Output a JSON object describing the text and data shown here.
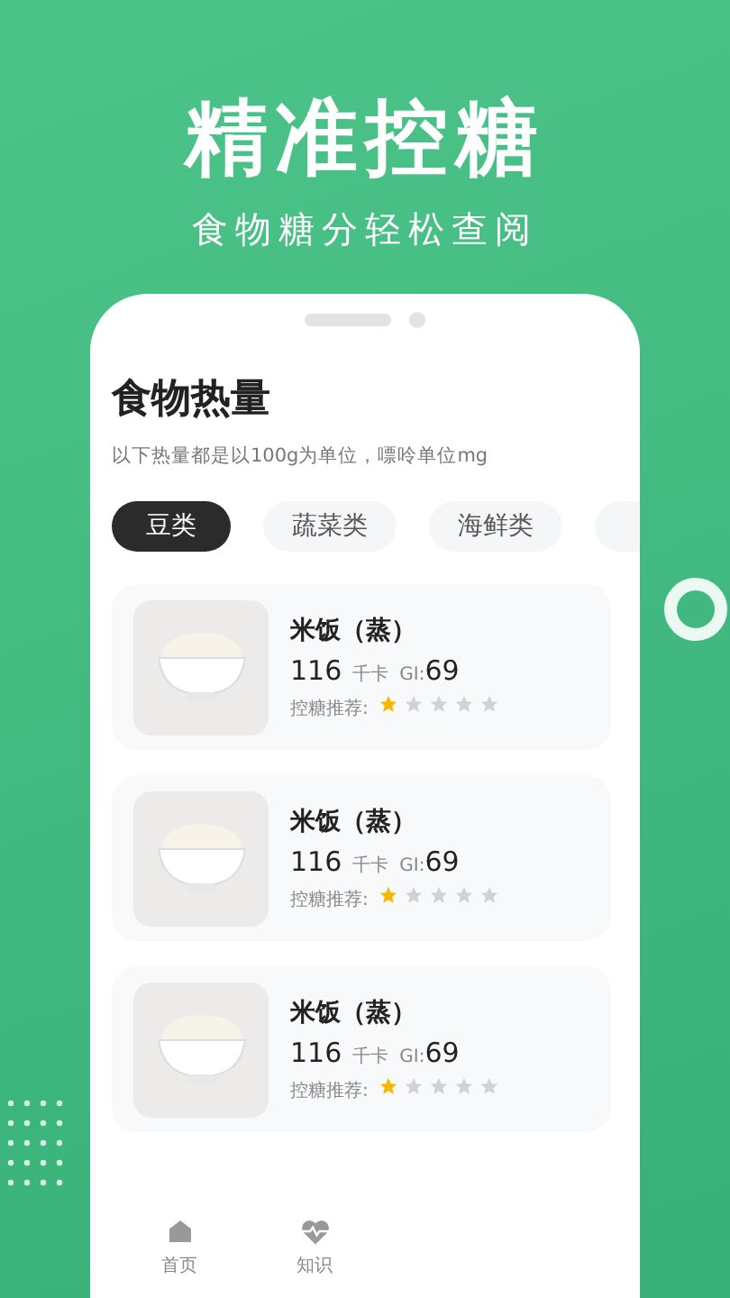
{
  "headline": "精准控糖",
  "subheadline": "食物糖分轻松查阅",
  "screen": {
    "title": "食物热量",
    "hint": "以下热量都是以100g为单位，嘌呤单位mg",
    "tabs": [
      {
        "label": "豆类",
        "selected": true
      },
      {
        "label": "蔬菜类",
        "selected": false
      },
      {
        "label": "海鲜类",
        "selected": false
      }
    ],
    "foods": [
      {
        "name": "米饭（蒸）",
        "calories": "116",
        "calorie_unit": "千卡",
        "gi_label": "GI:",
        "gi": "69",
        "rating_label": "控糖推荐:",
        "stars": 1
      },
      {
        "name": "米饭（蒸）",
        "calories": "116",
        "calorie_unit": "千卡",
        "gi_label": "GI:",
        "gi": "69",
        "rating_label": "控糖推荐:",
        "stars": 1
      },
      {
        "name": "米饭（蒸）",
        "calories": "116",
        "calorie_unit": "千卡",
        "gi_label": "GI:",
        "gi": "69",
        "rating_label": "控糖推荐:",
        "stars": 1
      }
    ],
    "nav": [
      {
        "label": "首页",
        "kind": "home"
      },
      {
        "label": "知识",
        "kind": "health"
      }
    ]
  }
}
